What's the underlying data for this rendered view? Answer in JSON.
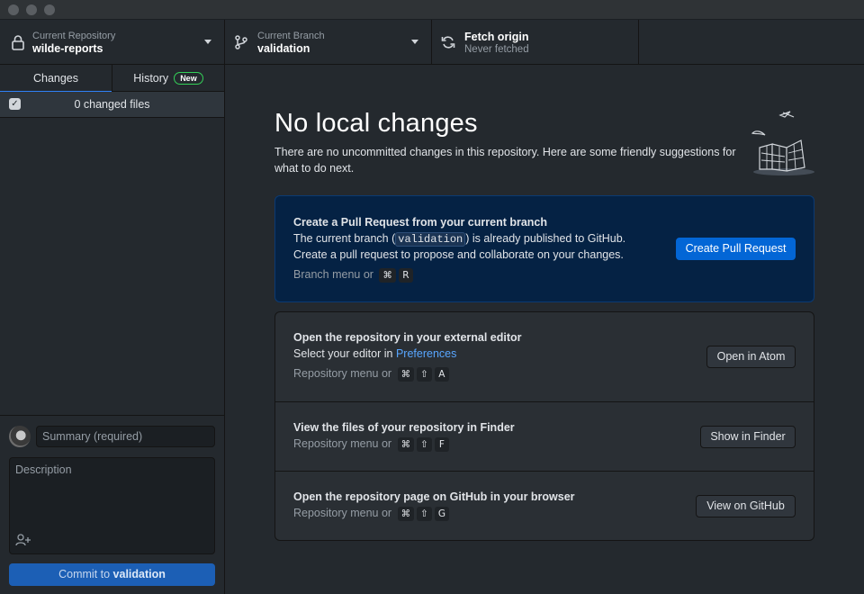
{
  "toolbar": {
    "repo": {
      "label": "Current Repository",
      "value": "wilde-reports"
    },
    "branch": {
      "label": "Current Branch",
      "value": "validation"
    },
    "fetch": {
      "label": "Fetch origin",
      "value": "Never fetched"
    }
  },
  "sidebar": {
    "tabs": [
      {
        "label": "Changes",
        "active": true
      },
      {
        "label": "History",
        "badge": "New"
      }
    ],
    "changed_files": "0 changed files",
    "summary_placeholder": "Summary (required)",
    "description_placeholder": "Description",
    "commit_prefix": "Commit to",
    "commit_branch": "validation"
  },
  "main": {
    "title": "No local changes",
    "subtitle": "There are no uncommitted changes in this repository. Here are some friendly suggestions for what to do next.",
    "pull_request": {
      "title": "Create a Pull Request from your current branch",
      "text_before": "The current branch (",
      "branch": "validation",
      "text_after": ") is already published to GitHub.",
      "text2": "Create a pull request to propose and collaborate on your changes.",
      "hint": "Branch menu or",
      "keys": [
        "⌘",
        "R"
      ],
      "button": "Create Pull Request"
    },
    "editor": {
      "title": "Open the repository in your external editor",
      "text": "Select your editor in",
      "link": "Preferences",
      "hint": "Repository menu or",
      "keys": [
        "⌘",
        "⇧",
        "A"
      ],
      "button": "Open in Atom"
    },
    "finder": {
      "title": "View the files of your repository in Finder",
      "hint": "Repository menu or",
      "keys": [
        "⌘",
        "⇧",
        "F"
      ],
      "button": "Show in Finder"
    },
    "github": {
      "title": "Open the repository page on GitHub in your browser",
      "hint": "Repository menu or",
      "keys": [
        "⌘",
        "⇧",
        "G"
      ],
      "button": "View on GitHub"
    }
  },
  "colors": {
    "accent": "#0366d6",
    "background": "#24292e",
    "card_blue": "#052244",
    "new_badge": "#34d058"
  }
}
